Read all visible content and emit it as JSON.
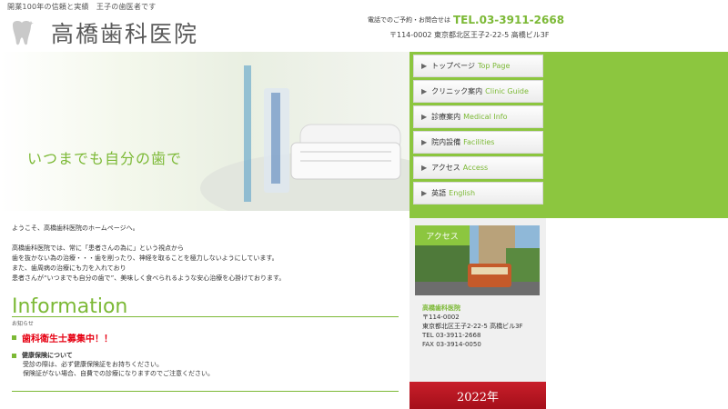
{
  "header": {
    "tagline": "開業100年の信頼と実績　王子の歯医者です",
    "clinic_name": "高橋歯科医院",
    "tel_note": "電話でのご予約・お問合せは",
    "tel": "TEL.03-3911-2668",
    "address": "〒114-0002 東京都北区王子2-22-5 高橋ビル3F"
  },
  "hero": {
    "tagline": "いつまでも自分の歯で"
  },
  "nav": [
    {
      "jp": "トップページ",
      "en": "Top Page"
    },
    {
      "jp": "クリニック案内",
      "en": "Clinic Guide"
    },
    {
      "jp": "診療案内",
      "en": "Medical Info"
    },
    {
      "jp": "院内設備",
      "en": "Facilities"
    },
    {
      "jp": "アクセス",
      "en": "Access"
    },
    {
      "jp": "英語",
      "en": "English"
    }
  ],
  "intro": {
    "welcome": "ようこそ、高橋歯科医院のホームページへ。",
    "p1": "高橋歯科医院では、常に「患者さんの為に」という視点から",
    "p2": "歯を抜かない為の治療・・・歯を削ったり、神経を取ることを極力しないようにしています。",
    "p3": "また、歯周病の治療にも力を入れており",
    "p4": "患者さんが“いつまでも自分の歯で”、美味しく食べられるような安心治療を心掛けております。"
  },
  "info": {
    "title": "Information",
    "sub": "お知らせ",
    "news1": "歯科衛生士募集中！！",
    "news2_title": "健康保険について",
    "news2_l1": "受診の際は、必ず健康保険証をお持ちください。",
    "news2_l2": "保険証がない場合、自費での診療になりますのでご注意ください。"
  },
  "side": {
    "access_label": "アクセス",
    "name": "高橋歯科医院",
    "zip": "〒114-0002",
    "addr": "東京都北区王子2-22-5 高橋ビル3F",
    "tel": "TEL 03-3911-2668",
    "fax": "FAX 03-3914-0050",
    "banner": "2022年"
  }
}
